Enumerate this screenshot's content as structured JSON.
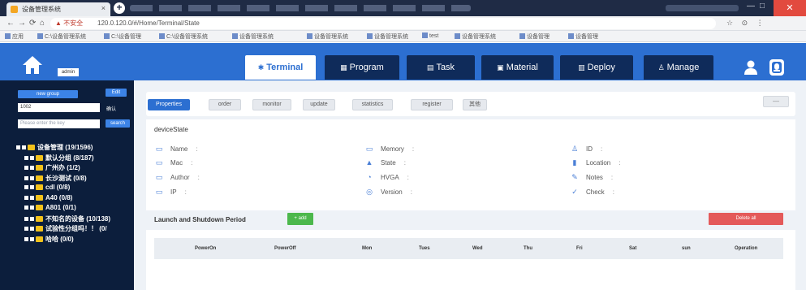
{
  "browser": {
    "tab_title": "设备管理系统",
    "tab_close": "×",
    "new_tab": "+",
    "win_minimize": "—",
    "win_maximize": "□",
    "win_close": "✕",
    "nav": {
      "back": "←",
      "forward": "→",
      "reload": "⟳",
      "home": "⌂"
    },
    "security_label": "▲ 不安全",
    "url": "120.0.120.0/#/Home/Terminal/State",
    "extensions": "☆ ⊙ ⋮",
    "bookmarks": [
      "应用",
      "C:\\设备管理系统",
      "C:\\设备管理",
      "C:\\设备管理系统",
      "设备管理系统",
      "设备管理系统",
      "设备管理系统",
      "test",
      "设备管理系统",
      "设备管理",
      "设备管理"
    ]
  },
  "header": {
    "user_label": "admin",
    "nav_tabs": [
      {
        "label": "Terminal",
        "icon": "✱",
        "icon_name": "monitor-icon",
        "active": true
      },
      {
        "label": "Program",
        "icon": "▦",
        "icon_name": "program-icon",
        "active": false
      },
      {
        "label": "Task",
        "icon": "▤",
        "icon_name": "task-icon",
        "active": false
      },
      {
        "label": "Material",
        "icon": "▣",
        "icon_name": "material-icon",
        "active": false
      },
      {
        "label": "Deploy",
        "icon": "▥",
        "icon_name": "deploy-icon",
        "active": false
      },
      {
        "label": "Manage",
        "icon": "♙",
        "icon_name": "manage-icon",
        "active": false
      }
    ]
  },
  "sidebar": {
    "new_group_label": "new group",
    "edit_label": "Edit",
    "group_input_value": "1002",
    "group_side_label": "确认",
    "search_placeholder": "Please enter the key",
    "search_label": "search",
    "tree": [
      {
        "label": "设备管理 (19/1596)",
        "indent": 0
      },
      {
        "label": "默认分组 (8/187)",
        "indent": 1
      },
      {
        "label": "广州办 (1/2)",
        "indent": 1
      },
      {
        "label": "长沙测试 (0/8)",
        "indent": 1
      },
      {
        "label": "cdl (0/8)",
        "indent": 1
      },
      {
        "label": "A40 (0/8)",
        "indent": 1
      },
      {
        "label": "A801 (0/1)",
        "indent": 1
      },
      {
        "label": "不知名的设备 (10/138)",
        "indent": 1
      },
      {
        "label": "试验性分组吗！！ (0/",
        "indent": 1
      },
      {
        "label": "哈哈 (0/0)",
        "indent": 1
      }
    ]
  },
  "subtabs": [
    "Properties",
    "order",
    "monitor",
    "update",
    "statistics",
    "register",
    "其他"
  ],
  "collapse_label": "—",
  "device_state": {
    "title": "deviceState",
    "fields": [
      {
        "label": "Name",
        "icon": "▭",
        "icon_name": "name-icon"
      },
      {
        "label": "Mac",
        "icon": "▭",
        "icon_name": "mac-icon"
      },
      {
        "label": "Author",
        "icon": "▭",
        "icon_name": "author-icon"
      },
      {
        "label": "IP",
        "icon": "▭",
        "icon_name": "ip-icon"
      },
      {
        "label": "Memory",
        "icon": "▭",
        "icon_name": "memory-icon"
      },
      {
        "label": "State",
        "icon": "▲",
        "icon_name": "state-icon"
      },
      {
        "label": "HVGA",
        "icon": "◔",
        "icon_name": "hvga-icon"
      },
      {
        "label": "Version",
        "icon": "◎",
        "icon_name": "version-icon"
      },
      {
        "label": "ID",
        "icon": "♙",
        "icon_name": "id-icon"
      },
      {
        "label": "Location",
        "icon": "▮",
        "icon_name": "location-icon"
      },
      {
        "label": "Notes",
        "icon": "✎",
        "icon_name": "notes-icon"
      },
      {
        "label": "Check",
        "icon": "✓",
        "icon_name": "check-icon"
      }
    ],
    "colon": ":"
  },
  "period": {
    "title": "Launch and Shutdown Period",
    "add_label": "+ add",
    "delete_label": "Delete all",
    "columns": [
      "PowerOn",
      "PowerOff",
      "Mon",
      "Tues",
      "Wed",
      "Thu",
      "Fri",
      "Sat",
      "sun",
      "Operation"
    ]
  },
  "colors": {
    "header_blue": "#2c6fd1",
    "nav_dark": "#0f2b5a",
    "sidebar_dark": "#0c1e3c",
    "add_green": "#4cb84c",
    "delete_red": "#e45a5a"
  }
}
